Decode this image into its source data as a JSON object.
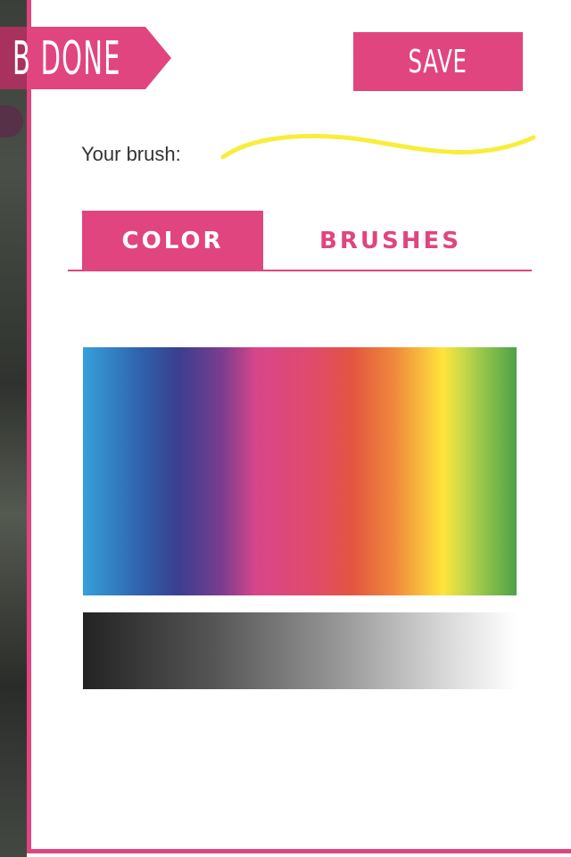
{
  "header": {
    "done_label": "B DONE",
    "save_label": "SAVE"
  },
  "brush": {
    "label": "Your brush:",
    "preview_color": "#f7ee3b"
  },
  "tabs": [
    {
      "label": "COLOR",
      "active": true
    },
    {
      "label": "BRUSHES",
      "active": false
    }
  ],
  "colors": {
    "accent": "#e0457f",
    "accent_dark": "#a8315d"
  }
}
